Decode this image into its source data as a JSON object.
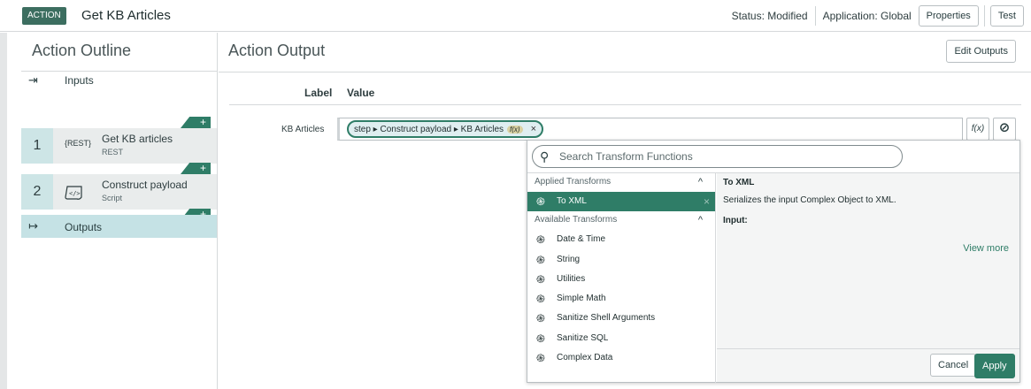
{
  "topbar": {
    "tag": "ACTION",
    "title": "Get KB Articles",
    "status": "Status: Modified",
    "application": "Application: Global",
    "properties_label": "Properties",
    "test_label": "Test"
  },
  "sidebar": {
    "title": "Action Outline",
    "inputs_label": "Inputs",
    "add_label": "+",
    "steps": [
      {
        "number": "1",
        "icon": "{REST}",
        "name": "Get KB articles",
        "type": "REST"
      },
      {
        "number": "2",
        "icon": "script-icon",
        "name": "Construct payload",
        "type": "Script"
      }
    ],
    "outputs_label": "Outputs"
  },
  "main": {
    "title": "Action Output",
    "edit_outputs_label": "Edit Outputs",
    "col_label": "Label",
    "col_value": "Value",
    "row": {
      "label": "KB Articles",
      "pill_text": "step ▸ Construct payload ▸ KB Articles",
      "pill_fx": "f(x)",
      "pill_remove": "×",
      "fx_button": "f(x)"
    }
  },
  "transform_popup": {
    "search_placeholder": "Search Transform Functions",
    "applied_header": "Applied Transforms",
    "applied": [
      {
        "label": "To XML",
        "remove": "×"
      }
    ],
    "available_header": "Available Transforms",
    "available": [
      {
        "label": "Date & Time"
      },
      {
        "label": "String"
      },
      {
        "label": "Utilities"
      },
      {
        "label": "Simple Math"
      },
      {
        "label": "Sanitize Shell Arguments"
      },
      {
        "label": "Sanitize SQL"
      },
      {
        "label": "Complex Data"
      }
    ],
    "detail": {
      "title": "To XML",
      "description": "Serializes the input Complex Object to XML.",
      "input_label": "Input:",
      "view_more": "View more",
      "cancel_label": "Cancel",
      "apply_label": "Apply"
    }
  },
  "colors": {
    "accent": "#2f7d67",
    "tag_bg": "#3c6e60",
    "outputs_bg": "#c5e2e5",
    "step_number_bg": "#cde5e6"
  }
}
